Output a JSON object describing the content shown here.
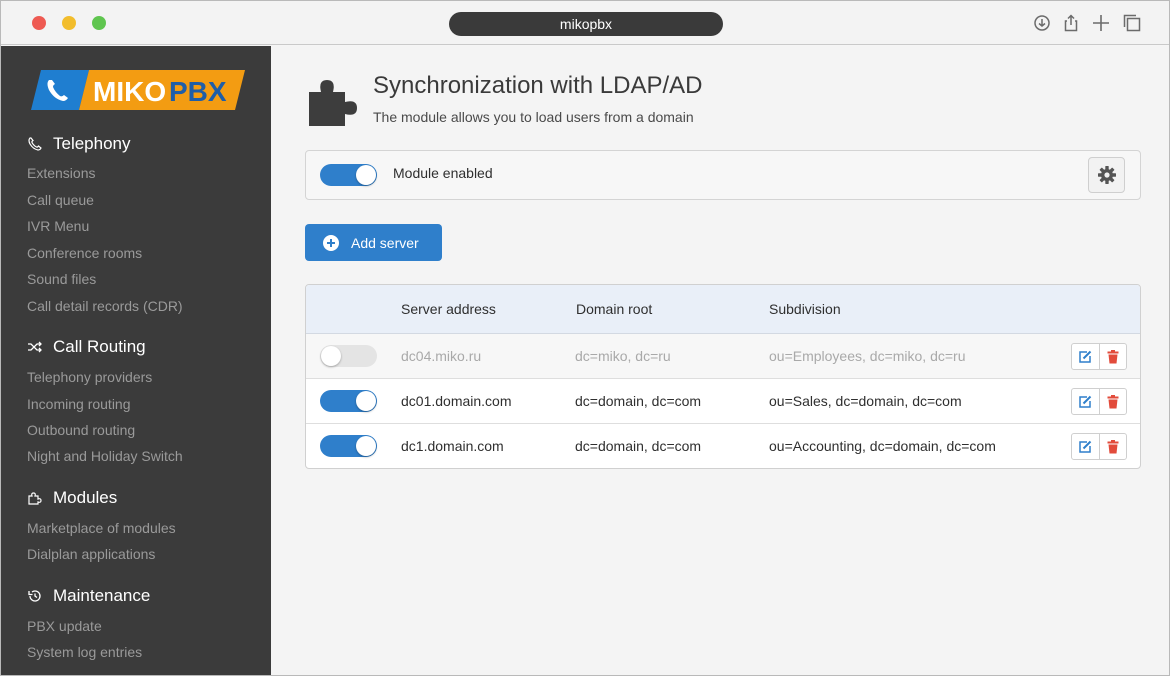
{
  "browser": {
    "url": "mikopbx"
  },
  "sidebar": {
    "sections": [
      {
        "title": "Telephony",
        "icon": "phone-icon",
        "items": [
          "Extensions",
          "Call queue",
          "IVR Menu",
          "Conference rooms",
          "Sound files",
          "Call detail records (CDR)"
        ]
      },
      {
        "title": "Call Routing",
        "icon": "shuffle-icon",
        "items": [
          "Telephony providers",
          "Incoming routing",
          "Outbound routing",
          "Night and Holiday Switch"
        ]
      },
      {
        "title": "Modules",
        "icon": "puzzle-icon",
        "items": [
          "Marketplace of modules",
          "Dialplan applications"
        ]
      },
      {
        "title": "Maintenance",
        "icon": "history-icon",
        "items": [
          "PBX update",
          "System log entries"
        ]
      }
    ]
  },
  "logo": {
    "text_a": "MIKO",
    "text_b": "PBX"
  },
  "page": {
    "title": "Synchronization with LDAP/AD",
    "subtitle": "The module allows you to load users from a domain"
  },
  "module": {
    "label": "Module enabled",
    "enabled": true
  },
  "add_server": {
    "label": "Add server"
  },
  "table": {
    "headers": [
      "Server address",
      "Domain root",
      "Subdivision"
    ],
    "rows": [
      {
        "enabled": false,
        "server": "dc04.miko.ru",
        "domain_root": "dc=miko, dc=ru",
        "subdivision": "ou=Employees, dc=miko, dc=ru"
      },
      {
        "enabled": true,
        "server": "dc01.domain.com",
        "domain_root": "dc=domain, dc=com",
        "subdivision": "ou=Sales, dc=domain, dc=com"
      },
      {
        "enabled": true,
        "server": "dc1.domain.com",
        "domain_root": "dc=domain, dc=com",
        "subdivision": "ou=Accounting, dc=domain, dc=com"
      }
    ]
  },
  "colors": {
    "accent": "#2f7fcb",
    "logo_orange": "#f39c12",
    "logo_blue": "#1f7ed0",
    "delete_red": "#e24b3b",
    "sidebar_bg": "#3b3b3b"
  }
}
